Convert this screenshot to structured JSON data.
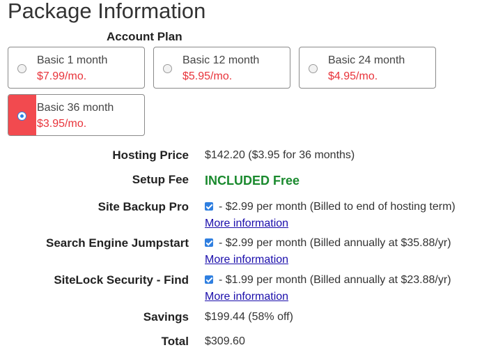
{
  "page": {
    "title": "Package Information"
  },
  "account_plan": {
    "label": "Account Plan",
    "plans": [
      {
        "name": "Basic 1 month",
        "price": "$7.99/mo.",
        "selected": false
      },
      {
        "name": "Basic 12 month",
        "price": "$5.95/mo.",
        "selected": false
      },
      {
        "name": "Basic 24 month",
        "price": "$4.95/mo.",
        "selected": false
      },
      {
        "name": "Basic 36 month",
        "price": "$3.95/mo.",
        "selected": true
      }
    ]
  },
  "summary": {
    "hosting_price": {
      "label": "Hosting Price",
      "value": "$142.20  ($3.95 for 36 months)"
    },
    "setup_fee": {
      "label": "Setup Fee",
      "value": "INCLUDED Free"
    },
    "site_backup": {
      "label": "Site Backup Pro",
      "checked": true,
      "value": "- $2.99 per month (Billed to end of hosting term)",
      "link": "More information"
    },
    "search_engine": {
      "label": "Search Engine Jumpstart",
      "checked": true,
      "value": "- $2.99 per month (Billed annually at $35.88/yr)",
      "link": "More information"
    },
    "sitelock": {
      "label": "SiteLock Security - Find",
      "checked": true,
      "value": "- $1.99 per month (Billed annually at $23.88/yr)",
      "link": "More information"
    },
    "savings": {
      "label": "Savings",
      "value": "$199.44 (58% off)"
    },
    "total": {
      "label": "Total",
      "value": "$309.60"
    }
  },
  "colors": {
    "selected_plan": "#f24a4f",
    "price_red": "#e8333a",
    "included_green": "#1a8a2e",
    "link_blue": "#1a0dab",
    "checkbox_blue": "#2f7fe0"
  }
}
